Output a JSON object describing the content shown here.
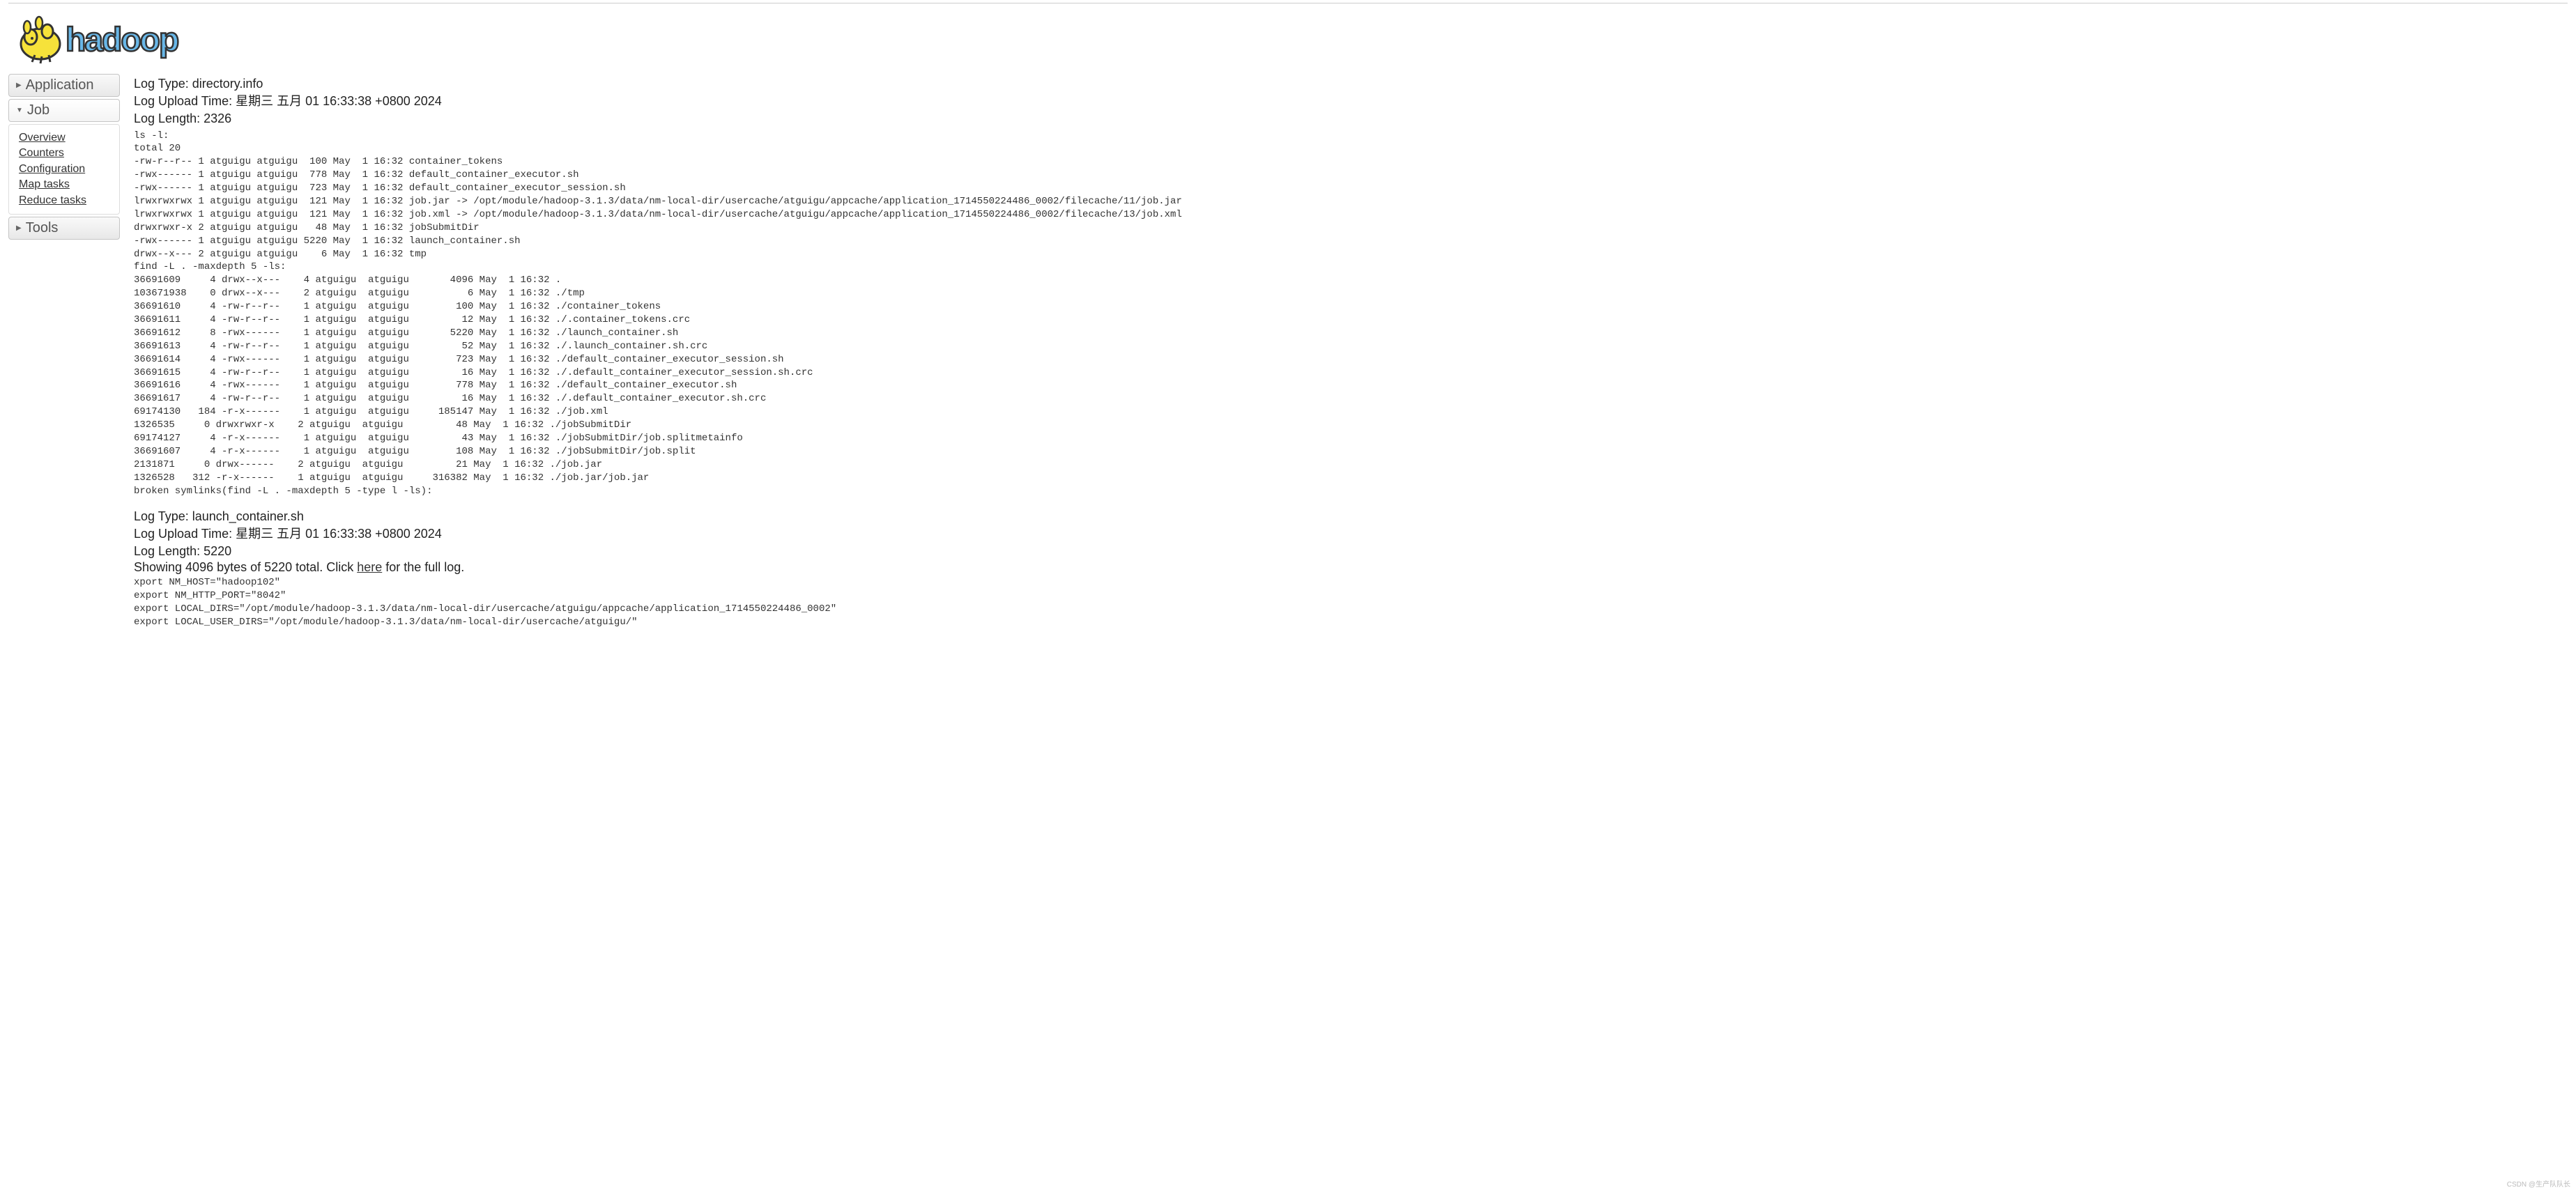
{
  "sidebar": {
    "application": {
      "label": "Application"
    },
    "job": {
      "label": "Job",
      "items": [
        {
          "label": "Overview"
        },
        {
          "label": "Counters"
        },
        {
          "label": "Configuration"
        },
        {
          "label": "Map tasks"
        },
        {
          "label": "Reduce tasks"
        }
      ]
    },
    "tools": {
      "label": "Tools"
    }
  },
  "log1": {
    "type_label": "Log Type: ",
    "type_value": "directory.info",
    "upload_label": "Log Upload Time: ",
    "upload_value": "星期三 五月 01 16:33:38 +0800 2024",
    "length_label": "Log Length: ",
    "length_value": "2326",
    "body": "ls -l:\ntotal 20\n-rw-r--r-- 1 atguigu atguigu  100 May  1 16:32 container_tokens\n-rwx------ 1 atguigu atguigu  778 May  1 16:32 default_container_executor.sh\n-rwx------ 1 atguigu atguigu  723 May  1 16:32 default_container_executor_session.sh\nlrwxrwxrwx 1 atguigu atguigu  121 May  1 16:32 job.jar -> /opt/module/hadoop-3.1.3/data/nm-local-dir/usercache/atguigu/appcache/application_1714550224486_0002/filecache/11/job.jar\nlrwxrwxrwx 1 atguigu atguigu  121 May  1 16:32 job.xml -> /opt/module/hadoop-3.1.3/data/nm-local-dir/usercache/atguigu/appcache/application_1714550224486_0002/filecache/13/job.xml\ndrwxrwxr-x 2 atguigu atguigu   48 May  1 16:32 jobSubmitDir\n-rwx------ 1 atguigu atguigu 5220 May  1 16:32 launch_container.sh\ndrwx--x--- 2 atguigu atguigu    6 May  1 16:32 tmp\nfind -L . -maxdepth 5 -ls:\n36691609     4 drwx--x---    4 atguigu  atguigu       4096 May  1 16:32 .\n103671938    0 drwx--x---    2 atguigu  atguigu          6 May  1 16:32 ./tmp\n36691610     4 -rw-r--r--    1 atguigu  atguigu        100 May  1 16:32 ./container_tokens\n36691611     4 -rw-r--r--    1 atguigu  atguigu         12 May  1 16:32 ./.container_tokens.crc\n36691612     8 -rwx------    1 atguigu  atguigu       5220 May  1 16:32 ./launch_container.sh\n36691613     4 -rw-r--r--    1 atguigu  atguigu         52 May  1 16:32 ./.launch_container.sh.crc\n36691614     4 -rwx------    1 atguigu  atguigu        723 May  1 16:32 ./default_container_executor_session.sh\n36691615     4 -rw-r--r--    1 atguigu  atguigu         16 May  1 16:32 ./.default_container_executor_session.sh.crc\n36691616     4 -rwx------    1 atguigu  atguigu        778 May  1 16:32 ./default_container_executor.sh\n36691617     4 -rw-r--r--    1 atguigu  atguigu         16 May  1 16:32 ./.default_container_executor.sh.crc\n69174130   184 -r-x------    1 atguigu  atguigu     185147 May  1 16:32 ./job.xml\n1326535     0 drwxrwxr-x    2 atguigu  atguigu         48 May  1 16:32 ./jobSubmitDir\n69174127     4 -r-x------    1 atguigu  atguigu         43 May  1 16:32 ./jobSubmitDir/job.splitmetainfo\n36691607     4 -r-x------    1 atguigu  atguigu        108 May  1 16:32 ./jobSubmitDir/job.split\n2131871     0 drwx------    2 atguigu  atguigu         21 May  1 16:32 ./job.jar\n1326528   312 -r-x------    1 atguigu  atguigu     316382 May  1 16:32 ./job.jar/job.jar\nbroken symlinks(find -L . -maxdepth 5 -type l -ls):"
  },
  "log2": {
    "type_label": "Log Type: ",
    "type_value": "launch_container.sh",
    "upload_label": "Log Upload Time: ",
    "upload_value": "星期三 五月 01 16:33:38 +0800 2024",
    "length_label": "Log Length: ",
    "length_value": "5220",
    "showing_prefix": "Showing 4096 bytes of 5220 total. Click ",
    "showing_link": "here",
    "showing_suffix": " for the full log.",
    "body": "xport NM_HOST=\"hadoop102\"\nexport NM_HTTP_PORT=\"8042\"\nexport LOCAL_DIRS=\"/opt/module/hadoop-3.1.3/data/nm-local-dir/usercache/atguigu/appcache/application_1714550224486_0002\"\nexport LOCAL_USER_DIRS=\"/opt/module/hadoop-3.1.3/data/nm-local-dir/usercache/atguigu/\""
  },
  "watermark": "CSDN @生产队队长"
}
